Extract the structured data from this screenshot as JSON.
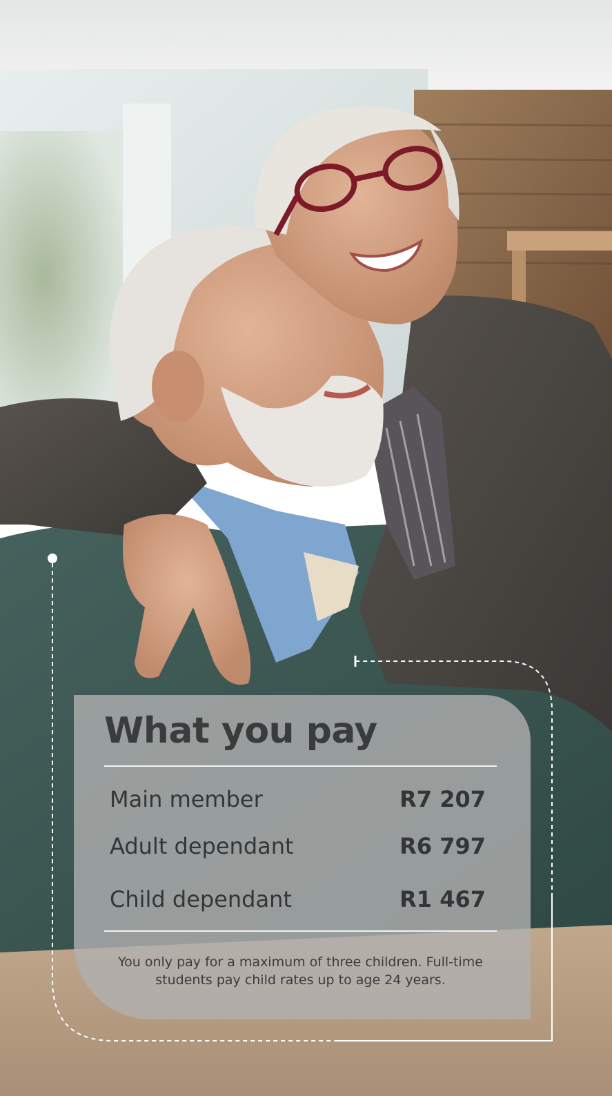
{
  "photo": {
    "description_icon": "couple-embrace-photo",
    "colors": {
      "ceiling": "#eceeee",
      "window": "#d8e4e4",
      "brick": "#8a6a4c",
      "table": "#b89f86",
      "sweater_green": "#3d5a56",
      "cardigan": "#4a4642",
      "shirt_blue": "#7fa6cf",
      "skin": "#d7a586",
      "hair": "#e4e0da",
      "glasses": "#7b1b28"
    }
  },
  "card": {
    "title": "What you pay",
    "rows": [
      {
        "label": "Main member",
        "value": "R7 207"
      },
      {
        "label": "Adult dependant",
        "value": "R6 797"
      },
      {
        "label": "Child dependant",
        "value": "R1 467"
      }
    ],
    "note": "You only pay for a maximum of three children. Full-time students pay child rates up to age 24 years.",
    "colors": {
      "panel": "#b0b0b0",
      "text": "#343538",
      "rule": "#f2f2f2"
    }
  }
}
